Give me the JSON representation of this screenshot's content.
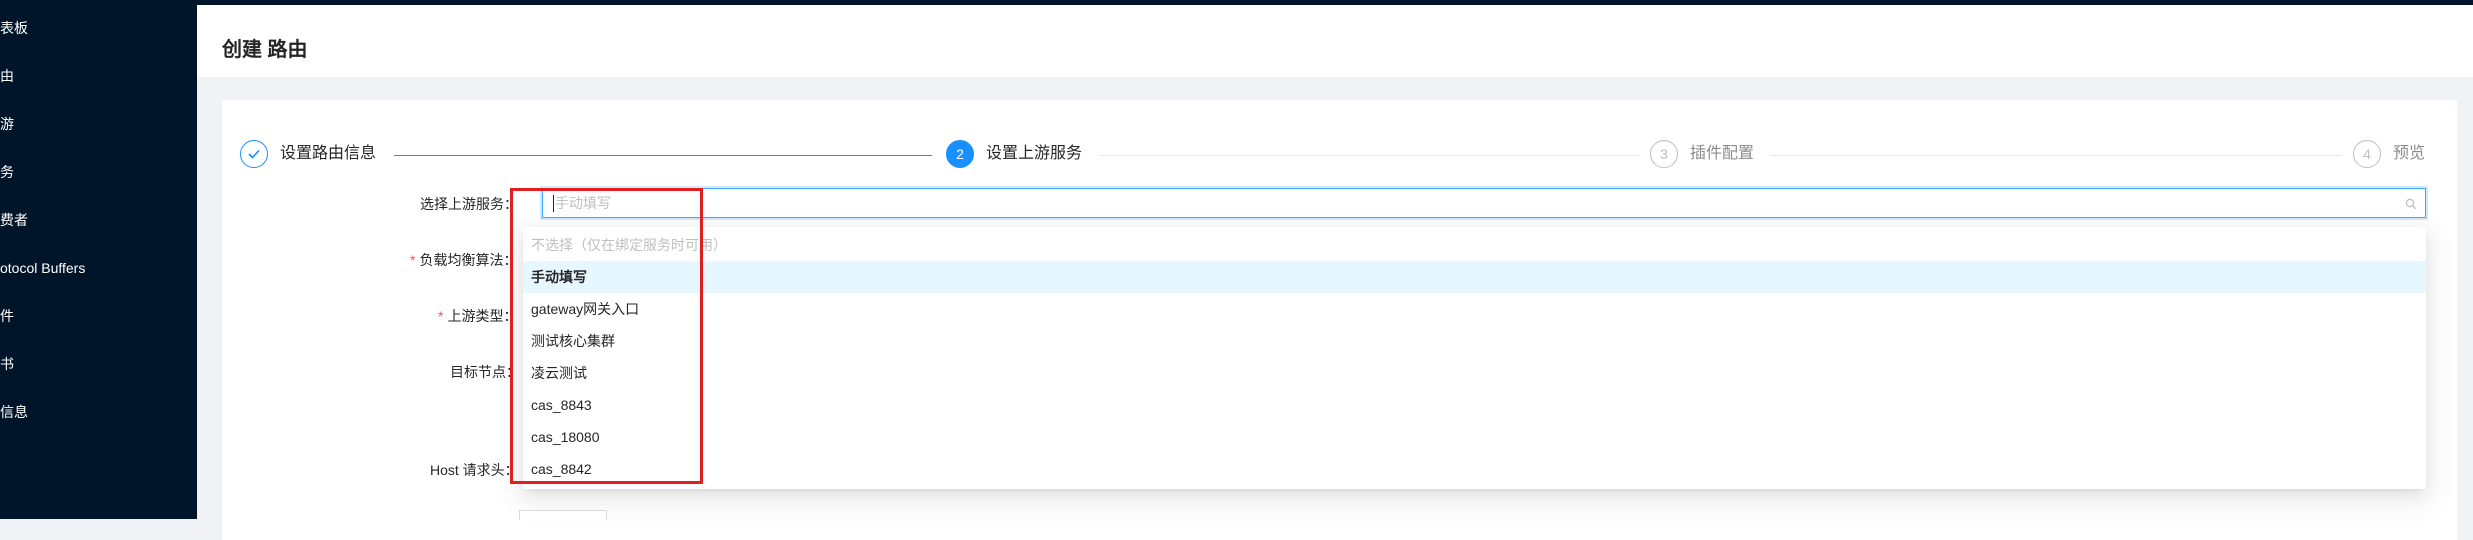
{
  "sidebar": {
    "items": [
      {
        "label": "仪表板"
      },
      {
        "label": "路由"
      },
      {
        "label": "上游"
      },
      {
        "label": "服务"
      },
      {
        "label": "消费者"
      },
      {
        "label": "Protocol Buffers"
      },
      {
        "label": "插件"
      },
      {
        "label": "证书"
      },
      {
        "label": "系统信息"
      }
    ]
  },
  "header": {
    "title": "创建 路由"
  },
  "steps": [
    {
      "number": "✓",
      "title": "设置路由信息",
      "status": "finish"
    },
    {
      "number": "2",
      "title": "设置上游服务",
      "status": "process"
    },
    {
      "number": "3",
      "title": "插件配置",
      "status": "wait"
    },
    {
      "number": "4",
      "title": "预览",
      "status": "wait"
    }
  ],
  "form": {
    "upstream_service_label": "选择上游服务：",
    "lb_algorithm_label": "负载均衡算法：",
    "upstream_type_label": "上游类型：",
    "target_nodes_label": "目标节点：",
    "host_header_label": "Host 请求头：",
    "select_placeholder": "手动填写"
  },
  "dropdown": {
    "options": [
      {
        "label": "不选择（仅在绑定服务时可用）",
        "state": "disabled"
      },
      {
        "label": "手动填写",
        "state": "selected"
      },
      {
        "label": "gateway网关入口",
        "state": "normal"
      },
      {
        "label": "测试核心集群",
        "state": "normal"
      },
      {
        "label": "凌云测试",
        "state": "normal"
      },
      {
        "label": "cas_8843",
        "state": "normal"
      },
      {
        "label": "cas_18080",
        "state": "normal"
      },
      {
        "label": "cas_8842",
        "state": "normal"
      }
    ]
  },
  "colors": {
    "sidebar_bg": "#001529",
    "primary": "#1890ff",
    "highlight_border": "#e02020",
    "selected_option_bg": "#e6f7ff"
  },
  "icons": {
    "search": "search-icon",
    "check": "check-icon"
  }
}
